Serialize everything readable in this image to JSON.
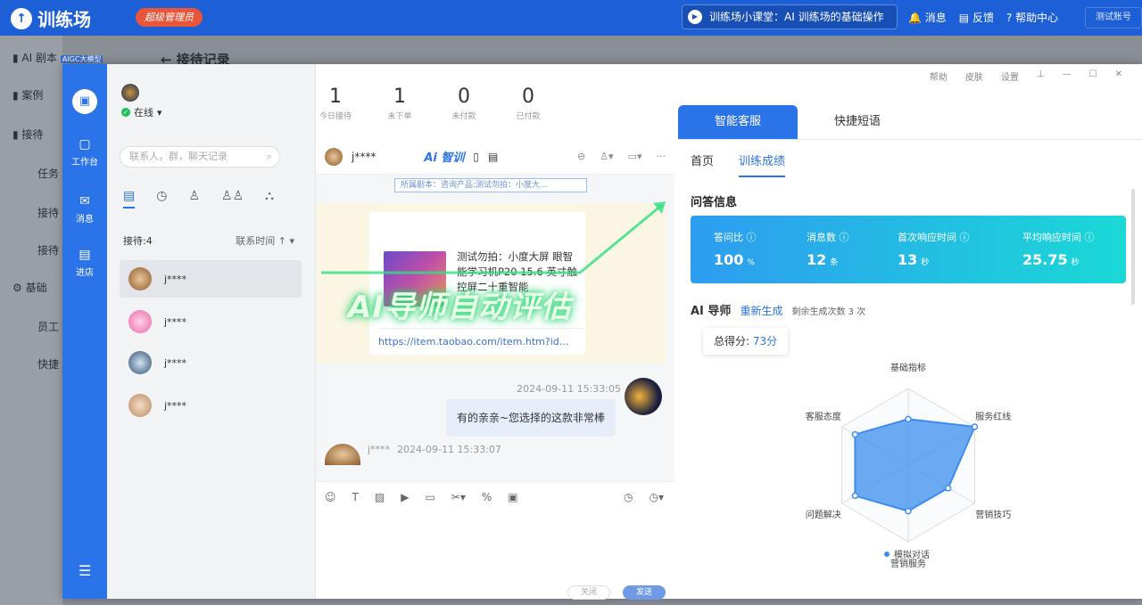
{
  "app": {
    "name": "训练场",
    "admin_badge": "超级管理员"
  },
  "topbar": {
    "lesson": "训练场小课堂：AI 训练场的基础操作",
    "links": [
      "消息",
      "反馈",
      "帮助中心"
    ],
    "account": "测试账号"
  },
  "bg_sidebar": {
    "items": [
      "AI 剧本",
      "案例",
      "接待",
      "任务",
      "接待",
      "接待",
      "基础",
      "员工",
      "快捷"
    ],
    "tag": "AIGC大模型"
  },
  "bg_title": "接待记录",
  "window": {
    "tools": [
      "帮助",
      "皮肤",
      "设置"
    ]
  },
  "rail": {
    "items": [
      "工作台",
      "消息",
      "进店"
    ]
  },
  "left": {
    "status": "在线",
    "search_placeholder": "联系人，群，聊天记录",
    "count_label": "接待:4",
    "sort_label": "联系时间 ↑",
    "contacts": [
      "j****",
      "j****",
      "j****",
      "j****"
    ]
  },
  "stats": [
    {
      "value": "1",
      "label": "今日接待"
    },
    {
      "value": "1",
      "label": "未下单"
    },
    {
      "value": "0",
      "label": "未付款"
    },
    {
      "value": "0",
      "label": "已付款"
    }
  ],
  "chat": {
    "contact": "j****",
    "ai_brand": "Ai 智训",
    "script_tag": "所属剧本：咨询产品:测试勿拍：小度大...",
    "product_title": "测试勿拍：小度大屏 眼智能学习机P20 15.6 英寸触控屏二十重智能",
    "product_link": "https://item.taobao.com/item.htm?id...",
    "msg_time": "2024-09-11 15:33:05",
    "msg_text": "有的亲亲~您选择的这款非常棒",
    "msg2_name": "j****",
    "msg2_time": "2024-09-11 15:33:07",
    "btn_close": "关闭",
    "btn_send": "发送"
  },
  "overlay": "AI导师自动评估",
  "right": {
    "tabs": [
      "智能客服",
      "快捷短语"
    ],
    "subtabs": [
      "首页",
      "训练成绩"
    ],
    "qa_title": "问答信息",
    "metrics": [
      {
        "label": "答问比",
        "value": "100",
        "unit": "%"
      },
      {
        "label": "消息数",
        "value": "12",
        "unit": "条"
      },
      {
        "label": "首次响应时间",
        "value": "13",
        "unit": "秒"
      },
      {
        "label": "平均响应时间",
        "value": "25.75",
        "unit": "秒"
      }
    ],
    "tutor_title": "AI 导师",
    "regen": "重新生成",
    "remaining": "剩余生成次数 3 次",
    "score_label": "总得分:",
    "score_value": "73分"
  },
  "chart_data": {
    "type": "radar",
    "axes": [
      "基础指标",
      "服务红线",
      "营销技巧",
      "营销服务",
      "问题解决",
      "客服态度"
    ],
    "series": [
      {
        "name": "模拟对话",
        "values": [
          60,
          100,
          60,
          60,
          80,
          80
        ]
      }
    ],
    "max": 100,
    "legend": "bottom"
  },
  "colors": {
    "primary": "#2b73e8",
    "accent": "#1ad9d6",
    "badge": "#e8553a"
  }
}
